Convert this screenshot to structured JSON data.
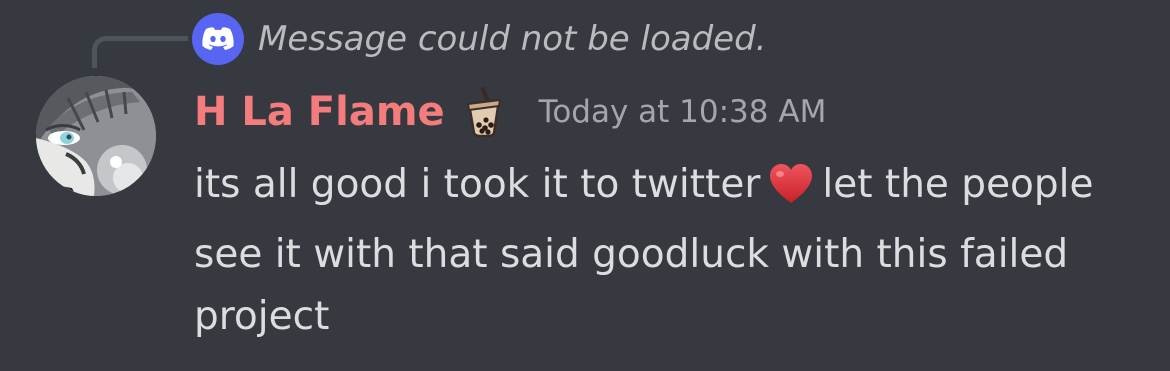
{
  "reply": {
    "text": "Message could not be loaded.",
    "icon": "discord-logo-icon"
  },
  "author": {
    "name": "H La Flame",
    "name_color": "#f47c7c",
    "role_icon": "bubble-tea-icon",
    "avatar_icon": "cartoon-avatar"
  },
  "message": {
    "timestamp": "Today at 10:38 AM",
    "text_before_emoji": "its all good i took it to twitter",
    "emoji": "red-heart-icon",
    "text_after_emoji": "let the people see it with that said goodluck with this failed project"
  },
  "theme": {
    "background": "#36393f",
    "blurple": "#5865f2"
  }
}
